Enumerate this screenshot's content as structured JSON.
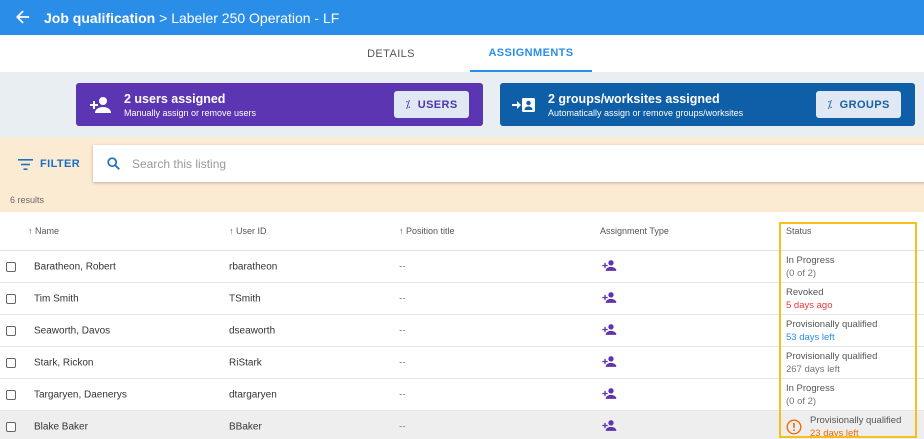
{
  "header": {
    "back_icon": "arrow-left-icon",
    "title_section": "Job qualification",
    "title_rest": " > Labeler 250 Operation - LF"
  },
  "tabs": [
    {
      "label": "DETAILS"
    },
    {
      "label": "ASSIGNMENTS",
      "active": true
    }
  ],
  "cards": {
    "users": {
      "title": "2 users assigned",
      "subtitle": "Manually assign or remove users",
      "button": "USERS",
      "icon": "person-add-icon",
      "color": "#5c35b2"
    },
    "groups": {
      "title": "2 groups/worksites assigned",
      "subtitle": "Automatically assign or remove groups/worksites",
      "button": "GROUPS",
      "icon": "assign-to-group-icon",
      "color": "#0f5ea8"
    }
  },
  "filter": {
    "label": "FILTER",
    "search_placeholder": "Search this listing",
    "results": "6 results"
  },
  "columns": {
    "name": "Name",
    "user_id": "User ID",
    "position": "Position title",
    "type": "Assignment Type",
    "status": "Status"
  },
  "rows": [
    {
      "name": "Baratheon, Robert",
      "user_id": "rbaratheon",
      "position": "--",
      "status1": "In Progress",
      "status2": "(0 of 2)"
    },
    {
      "name": "Tim Smith",
      "user_id": "TSmith",
      "position": "--",
      "status1": "Revoked",
      "status2": "5 days ago"
    },
    {
      "name": "Seaworth, Davos",
      "user_id": "dseaworth",
      "position": "--",
      "status1": "Provisionally qualified",
      "status2": "53 days left"
    },
    {
      "name": "Stark, Rickon",
      "user_id": "RiStark",
      "position": "--",
      "status1": "Provisionally qualified",
      "status2": "267 days left"
    },
    {
      "name": "Targaryen, Daenerys",
      "user_id": "dtargaryen",
      "position": "--",
      "status1": "In Progress",
      "status2": "(0 of 2)"
    },
    {
      "name": "Blake Baker",
      "user_id": "BBaker",
      "position": "--",
      "status1": "Provisionally qualified",
      "status2": "23 days left"
    }
  ],
  "colors": {
    "app_bar": "#2a8ee8",
    "highlight_border": "#f5c01e",
    "revoked": "#e53935",
    "days_left_blue": "#2a8ee8",
    "warning": "#ef6c00"
  }
}
